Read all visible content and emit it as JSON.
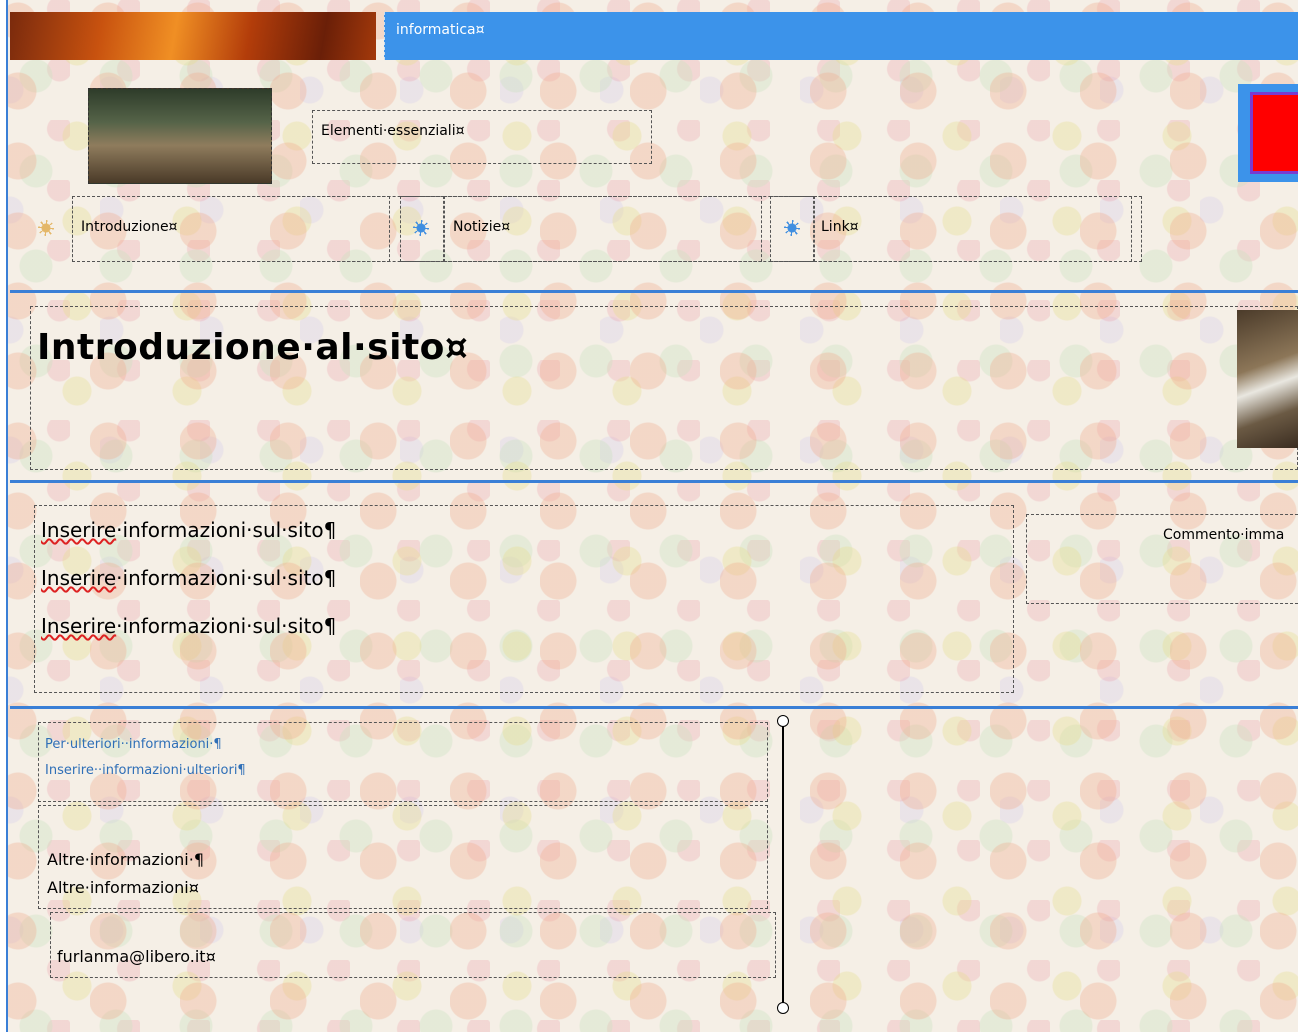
{
  "header": {
    "site_title": "informatica¤"
  },
  "tagline": "Elementi·essenziali¤",
  "nav": {
    "items": [
      {
        "label": "Introduzione¤",
        "active": true
      },
      {
        "label": "Notizie¤",
        "active": false
      },
      {
        "label": "Link¤",
        "active": false
      }
    ]
  },
  "page": {
    "title": "Introduzione·al·sito¤",
    "paragraphs": [
      {
        "word": "Inserire",
        "rest": "·informazioni·sul·sito¶"
      },
      {
        "word": "Inserire",
        "rest": "·informazioni·sul·sito¶"
      },
      {
        "word": "Inserire",
        "rest": "·informazioni·sul·sito¶"
      }
    ],
    "image_caption": "Commento·imma"
  },
  "footer": {
    "more_info_line1": "Per·ulteriori··informazioni·¶",
    "more_info_line2": "Inserire··informazioni·ulteriori¶",
    "other_info_line1": "Altre·informazioni·¶",
    "other_info_line2": "Altre·informazioni¤",
    "email": "furlanma@libero.it¤"
  },
  "colors": {
    "accent_blue": "#3c93ea",
    "rule_blue": "#3a7fd6",
    "logo_red": "#ff0000"
  }
}
